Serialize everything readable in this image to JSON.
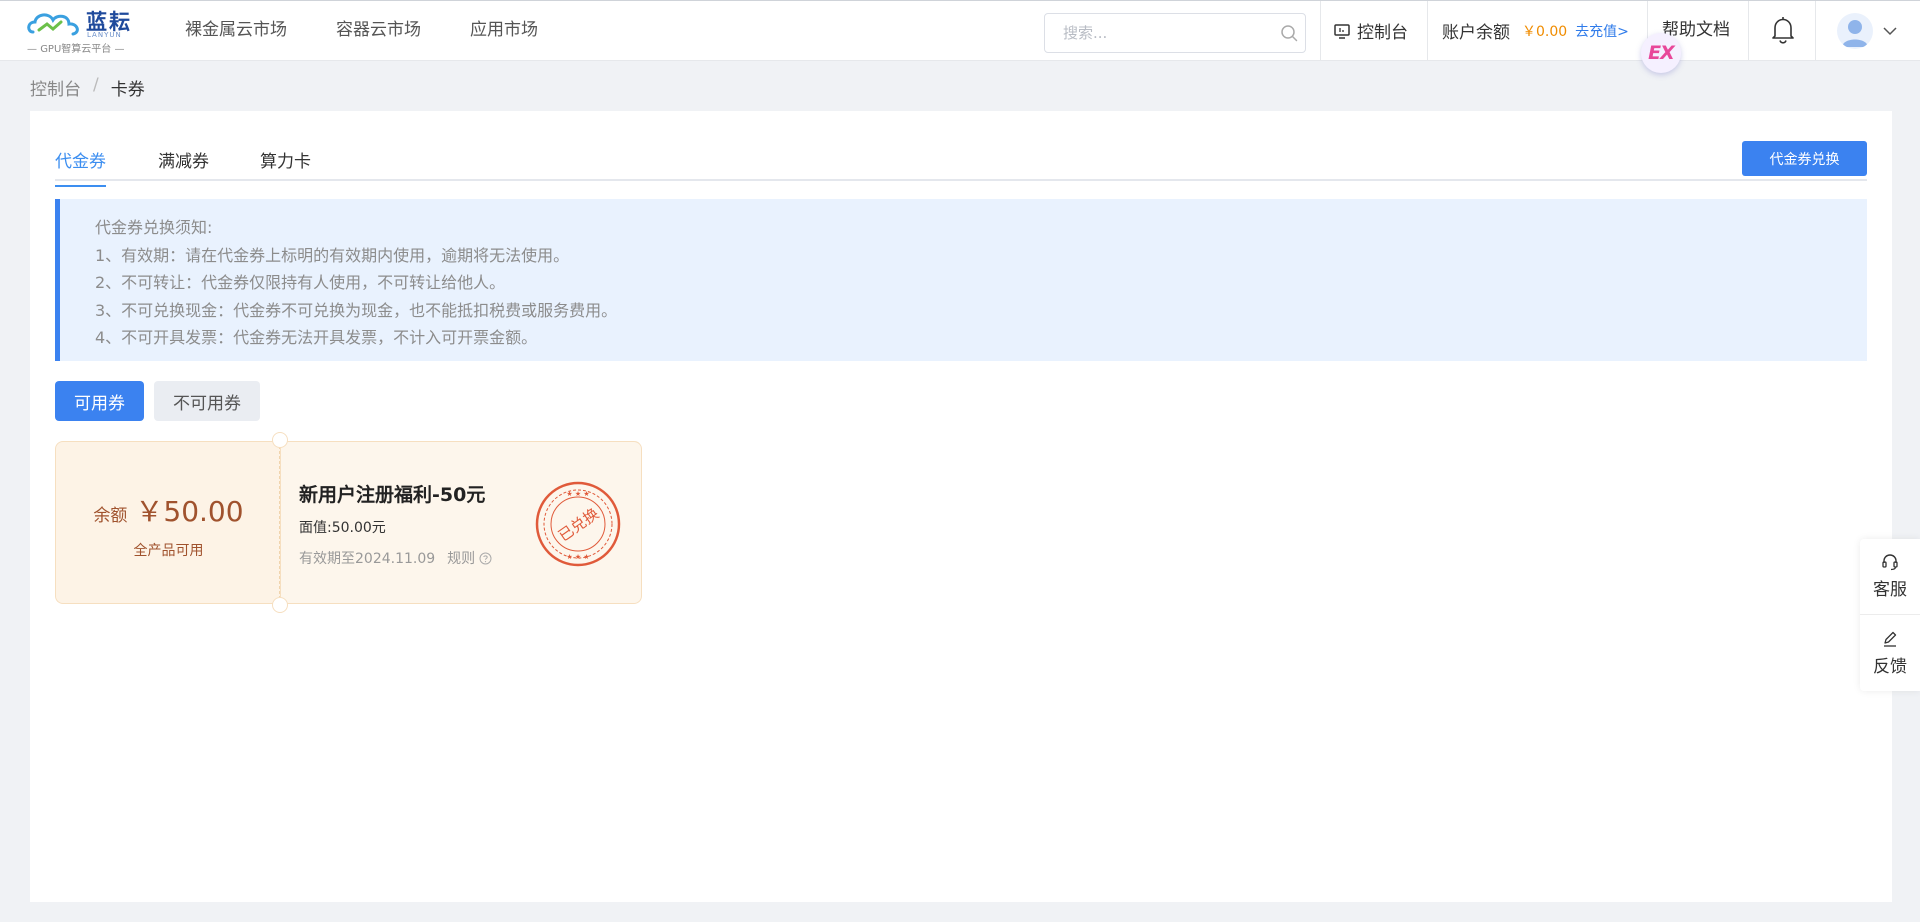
{
  "header": {
    "logo": {
      "brand_cn": "蓝耘",
      "brand_en": "LANYUN",
      "subtitle": "GPU智算云平台"
    },
    "nav": [
      "裸金属云市场",
      "容器云市场",
      "应用市场"
    ],
    "search_placeholder": "搜索...",
    "console_label": "控制台",
    "balance_label": "账户余额",
    "balance_amount": "￥0.00",
    "recharge_label": "去充值>",
    "help_label": "帮助文档",
    "ex_badge": "EX"
  },
  "breadcrumb": {
    "home": "控制台",
    "separator": "/",
    "current": "卡券"
  },
  "tabs": [
    {
      "label": "代金券",
      "active": true
    },
    {
      "label": "满减券",
      "active": false
    },
    {
      "label": "算力卡",
      "active": false
    }
  ],
  "redeem_button": "代金券兑换",
  "notice": {
    "title": "代金券兑换须知:",
    "lines": [
      "1、有效期：请在代金券上标明的有效期内使用，逾期将无法使用。",
      "2、不可转让：代金券仅限持有人使用，不可转让给他人。",
      "3、不可兑换现金：代金券不可兑换为现金，也不能抵扣税费或服务费用。",
      "4、不可开具发票：代金券无法开具发票，不计入可开票金额。"
    ]
  },
  "filters": {
    "available": "可用券",
    "unavailable": "不可用券"
  },
  "coupon": {
    "balance_label": "余额",
    "balance_value": "￥50.00",
    "scope": "全产品可用",
    "title": "新用户注册福利-50元",
    "face_value": "面值:50.00元",
    "expire": "有效期至2024.11.09",
    "rules": "规则",
    "stamp_text": "已兑换"
  },
  "side_tools": {
    "service": "客服",
    "feedback": "反馈"
  },
  "colors": {
    "primary": "#3b82f0",
    "balance_amount": "#f08c00",
    "coupon_text": "#a0522d",
    "stamp": "#e05a3a"
  }
}
